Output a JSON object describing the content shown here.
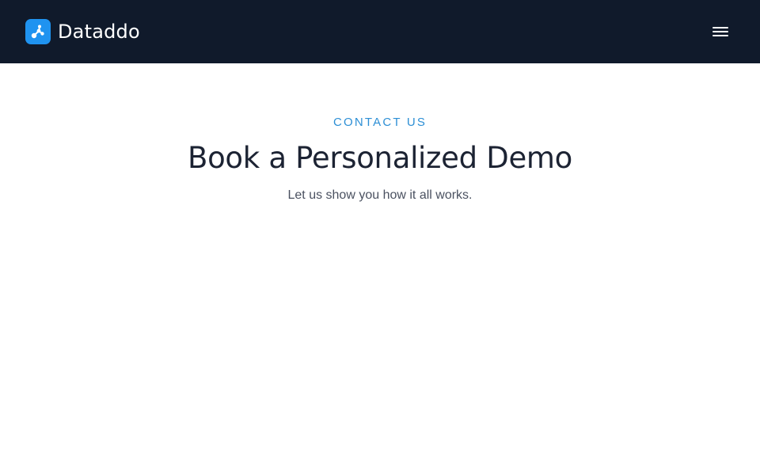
{
  "header": {
    "brand_name": "Dataddo",
    "brand_icon": "dataddo-logo-icon",
    "menu_icon": "hamburger-menu-icon",
    "background_color": "#101a2b",
    "accent_color": "#1f93f0"
  },
  "hero": {
    "eyebrow": "CONTACT US",
    "title": "Book a Personalized Demo",
    "subtitle": "Let us show you how it all works.",
    "eyebrow_color": "#2d8fd5"
  }
}
